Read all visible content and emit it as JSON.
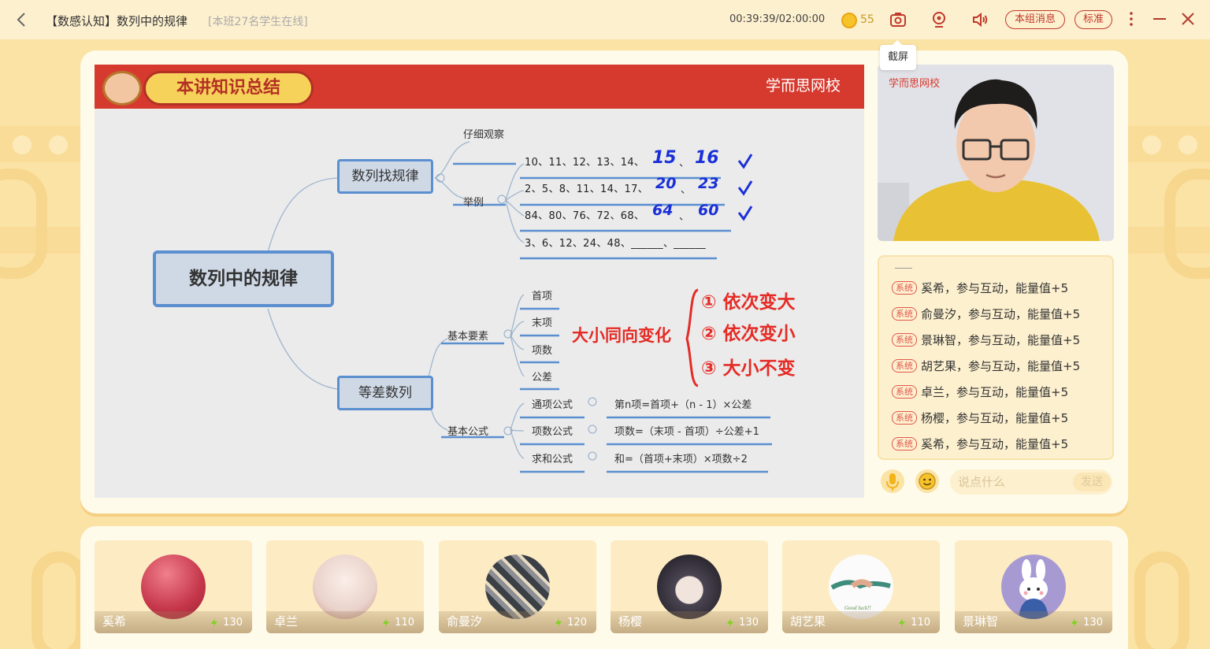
{
  "topbar": {
    "title": "【数感认知】数列中的规律",
    "online": "[本班27名学生在线]",
    "timer": "00:39:39/02:00:00",
    "coins": "55",
    "group_msg_label": "本组消息",
    "quality_label": "标准",
    "tooltip": "截屏"
  },
  "slide": {
    "header_title": "本讲知识总结",
    "brand": "学而思网校",
    "root": "数列中的规律",
    "branch1": "数列找规律",
    "observe": "仔细观察",
    "example": "举例",
    "seq1": "10、11、12、13、14、",
    "seq2": "2、5、8、11、14、17、",
    "seq3": "84、80、76、72、68、",
    "seq4": "3、6、12、24、48、______、______",
    "hw1a": "15",
    "hw1b": "16",
    "hw2a": "20",
    "hw2b": "23",
    "hw3a": "64",
    "hw3b": "60",
    "branch2": "等差数列",
    "basic_elements": "基本要素",
    "first": "首项",
    "last": "末项",
    "count": "项数",
    "diff": "公差",
    "basic_formula": "基本公式",
    "f1": "通项公式",
    "f2": "项数公式",
    "f3": "求和公式",
    "f1v": "第n项=首项+（n - 1）×公差",
    "f2v": "项数=（末项 - 首项）÷公差+1",
    "f3v": "和=（首项+末项）×项数÷2",
    "hw_note": "大小同向变化",
    "hw_r1": "① 依次变大",
    "hw_r2": "② 依次变小",
    "hw_r3": "③ 大小不变"
  },
  "video": {
    "brand": "学而思网校"
  },
  "chat": {
    "sys_tag": "系统",
    "messages": [
      "奚希，参与互动，能量值+5",
      "俞曼汐，参与互动，能量值+5",
      "景琳智，参与互动，能量值+5",
      "胡艺果，参与互动，能量值+5",
      "卓兰，参与互动，能量值+5",
      "杨樱，参与互动，能量值+5",
      "奚希，参与互动，能量值+5"
    ],
    "placeholder": "说点什么",
    "send_label": "发送"
  },
  "students": [
    {
      "name": "奚希",
      "energy": "130"
    },
    {
      "name": "卓兰",
      "energy": "110"
    },
    {
      "name": "俞曼汐",
      "energy": "120"
    },
    {
      "name": "杨樱",
      "energy": "130"
    },
    {
      "name": "胡艺果",
      "energy": "110"
    },
    {
      "name": "景琳智",
      "energy": "130"
    }
  ],
  "avatar_text": {
    "hujiguo": "Good luck!!"
  },
  "colors": {
    "accent": "#c0392b",
    "slide_red": "#d63a2e",
    "mindmap_blue": "#5b8fd0",
    "bg": "#fbe3a6"
  }
}
